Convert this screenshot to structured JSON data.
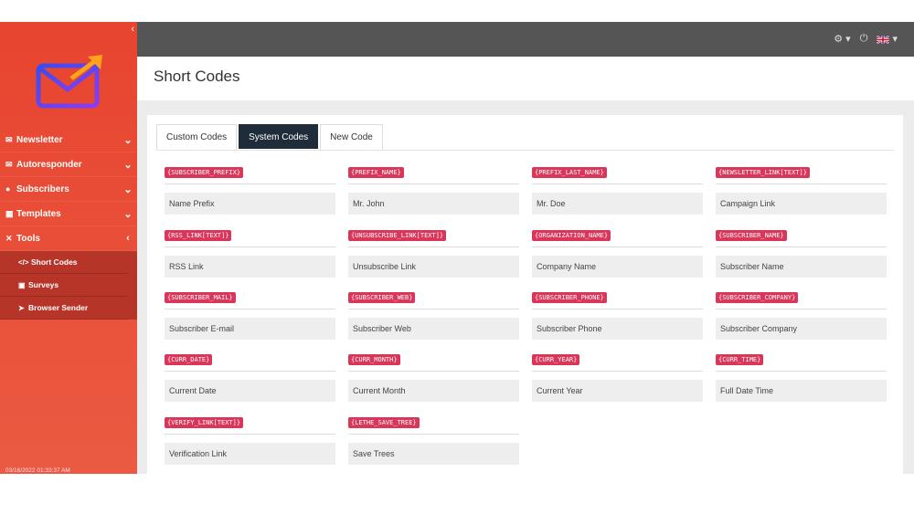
{
  "sidebar": {
    "items": [
      {
        "label": "Newsletter",
        "icon": "envelope-icon",
        "chev": "⌄"
      },
      {
        "label": "Autoresponder",
        "icon": "autoresponder-icon",
        "chev": "⌄"
      },
      {
        "label": "Subscribers",
        "icon": "users-icon",
        "chev": "⌄"
      },
      {
        "label": "Templates",
        "icon": "templates-icon",
        "chev": "⌄"
      },
      {
        "label": "Tools",
        "icon": "tools-icon",
        "chev": "‹"
      }
    ],
    "subitems": [
      {
        "label": "Short Codes",
        "icon": "code-icon"
      },
      {
        "label": "Surveys",
        "icon": "survey-icon"
      },
      {
        "label": "Browser Sender",
        "icon": "send-icon"
      }
    ],
    "date": "03/16/2022 01:33:37 AM"
  },
  "header": {
    "title": "Short Codes"
  },
  "tabs": [
    {
      "label": "Custom Codes",
      "active": false
    },
    {
      "label": "System Codes",
      "active": true
    },
    {
      "label": "New Code",
      "active": false
    }
  ],
  "codes": [
    {
      "code": "{SUBSCRIBER_PREFIX}",
      "value": "Name Prefix"
    },
    {
      "code": "{PREFIX_NAME}",
      "value": "Mr. John"
    },
    {
      "code": "{PREFIX_LAST_NAME}",
      "value": "Mr. Doe"
    },
    {
      "code": "{NEWSLETTER_LINK[TEXT]}",
      "value": "Campaign Link"
    },
    {
      "code": "{RSS_LINK[TEXT]}",
      "value": "RSS Link"
    },
    {
      "code": "{UNSUBSCRIBE_LINK[TEXT]}",
      "value": "Unsubscribe Link"
    },
    {
      "code": "{ORGANIZATION_NAME}",
      "value": "Company Name"
    },
    {
      "code": "{SUBSCRIBER_NAME}",
      "value": "Subscriber Name"
    },
    {
      "code": "{SUBSCRIBER_MAIL}",
      "value": "Subscriber E-mail"
    },
    {
      "code": "{SUBSCRIBER_WEB}",
      "value": "Subscriber Web"
    },
    {
      "code": "{SUBSCRIBER_PHONE}",
      "value": "Subscriber Phone"
    },
    {
      "code": "{SUBSCRIBER_COMPANY}",
      "value": "Subscriber Company"
    },
    {
      "code": "{CURR_DATE}",
      "value": "Current Date"
    },
    {
      "code": "{CURR_MONTH}",
      "value": "Current Month"
    },
    {
      "code": "{CURR_YEAR}",
      "value": "Current Year"
    },
    {
      "code": "{CURR_TIME}",
      "value": "Full Date Time"
    },
    {
      "code": "{VERIFY_LINK[TEXT]}",
      "value": "Verification Link"
    },
    {
      "code": "{LETHE_SAVE_TREE}",
      "value": "Save Trees"
    }
  ],
  "colors": {
    "sidebar": "#e8442f",
    "topbar": "#555555",
    "code_badge": "#d9365a",
    "active_tab": "#1f2d3a"
  }
}
